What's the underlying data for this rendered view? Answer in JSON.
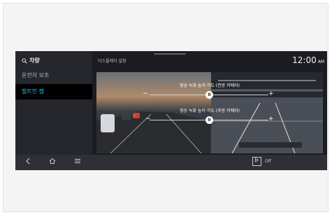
{
  "sidebar": {
    "header": "차량",
    "header_icon": "search-icon",
    "items": [
      {
        "label": "운전자 보조"
      },
      {
        "label": "빌트인 캠"
      }
    ]
  },
  "topbar": {
    "title": "디스플레이 설정",
    "clock": "12:00",
    "ampm": "AM"
  },
  "camera": {
    "front_label": "영상 녹화 높이 각도 (전방 카메라)",
    "front_value": "0",
    "rear_label": "영상 녹화 높이 각도 (후방 카메라)",
    "rear_value": "0",
    "minus": "−",
    "plus": "+"
  },
  "bottom": {
    "back_icon": "chevron-left-icon",
    "home_icon": "home-icon",
    "menu_icon": "menu-icon",
    "toggle_icon": "play-icon",
    "toggle_label": "Off"
  },
  "colors": {
    "accent": "#34c0e8",
    "screen_bg": "#1b1d22"
  }
}
